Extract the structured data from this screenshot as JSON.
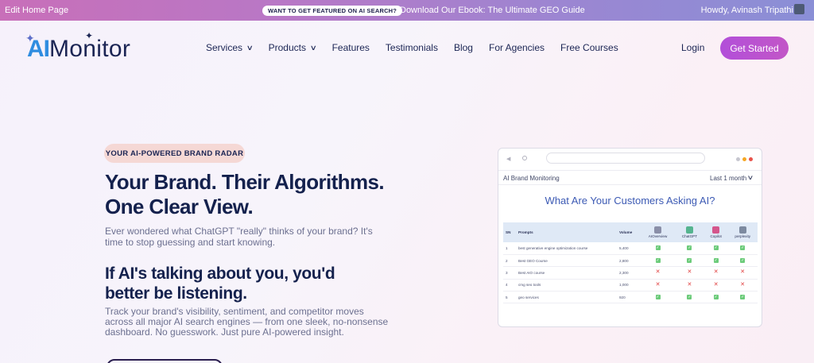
{
  "admin_bar": {
    "edit_label": "Edit Home Page",
    "featured_badge": "WANT TO GET FEATURED ON AI SEARCH?",
    "ebook_link": "Download Our Ebook: The Ultimate GEO Guide",
    "howdy": "Howdy, Avinash Tripathi"
  },
  "header": {
    "logo_ai": "AI",
    "logo_rest": "Monitor",
    "nav": [
      {
        "label": "Services",
        "has_dropdown": true
      },
      {
        "label": "Products",
        "has_dropdown": true
      },
      {
        "label": "Features",
        "has_dropdown": false
      },
      {
        "label": "Testimonials",
        "has_dropdown": false
      },
      {
        "label": "Blog",
        "has_dropdown": false
      },
      {
        "label": "For Agencies",
        "has_dropdown": false
      },
      {
        "label": "Free Courses",
        "has_dropdown": false
      }
    ],
    "login_label": "Login",
    "cta_label": "Get Started"
  },
  "hero": {
    "pill": "YOUR AI-POWERED BRAND RADAR",
    "headline_line1": "Your Brand. Their Algorithms.",
    "headline_line2": "One Clear View.",
    "subtext": "Ever wondered what ChatGPT \"really\" thinks of your brand? It's time to stop guessing and start knowing.",
    "headline2_line1": "If AI's talking about you, you'd",
    "headline2_line2": "better be listening.",
    "body": "Track your brand's visibility, sentiment, and competitor moves across all major AI search engines — from one sleek, no-nonsense dashboard. No guesswork. Just pure AI-powered insight."
  },
  "dashboard": {
    "panel_title": "AI Brand Monitoring",
    "period": "Last 1 month",
    "question": "What Are Your Customers Asking AI?",
    "columns": {
      "sn": "SN",
      "prompts": "Prompts",
      "volume": "Volume"
    },
    "engines": [
      {
        "name": "AIOverview",
        "color": "#8a8fa8"
      },
      {
        "name": "ChatGPT",
        "color": "#55b48f"
      },
      {
        "name": "Copilot",
        "color": "#d4568c"
      },
      {
        "name": "perplexity",
        "color": "#7d8aa0"
      }
    ],
    "rows": [
      {
        "sn": "1",
        "prompt": "best generative engine optimization course",
        "volume": "5,400",
        "marks": [
          true,
          true,
          true,
          true
        ]
      },
      {
        "sn": "2",
        "prompt": "Best GEO Course",
        "volume": "2,800",
        "marks": [
          true,
          true,
          true,
          true
        ]
      },
      {
        "sn": "3",
        "prompt": "Best AIO course",
        "volume": "2,300",
        "marks": [
          false,
          false,
          false,
          false
        ]
      },
      {
        "sn": "4",
        "prompt": "cmg seo tools",
        "volume": "1,000",
        "marks": [
          false,
          false,
          false,
          false
        ]
      },
      {
        "sn": "5",
        "prompt": "geo services",
        "volume": "920",
        "marks": [
          true,
          true,
          true,
          true
        ]
      }
    ]
  },
  "colors": {
    "accent": "#b24fd9",
    "navy": "#14214d",
    "pill_bg": "#f5d8d5",
    "question_blue": "#3c5ab4"
  }
}
